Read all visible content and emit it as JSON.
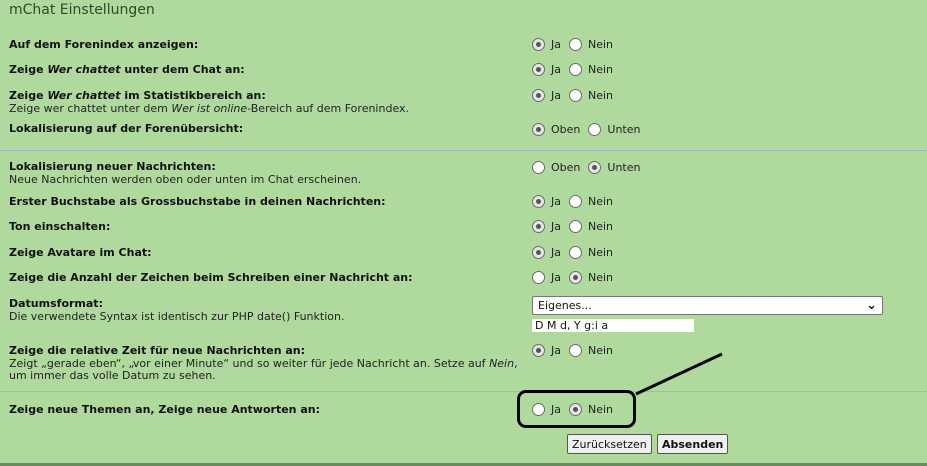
{
  "title": "mChat Einstellungen",
  "rows": [
    {
      "label": "Auf dem Forenindex anzeigen:",
      "opt1": "Ja",
      "opt2": "Nein",
      "selected": 1
    },
    {
      "label_parts": [
        "Zeige ",
        "Wer chattet",
        " unter dem Chat an:"
      ],
      "opt1": "Ja",
      "opt2": "Nein",
      "selected": 1
    },
    {
      "label_parts": [
        "Zeige ",
        "Wer chattet",
        " im Statistikbereich an:"
      ],
      "explain_parts": [
        "Zeige wer chattet unter dem ",
        "Wer ist online",
        "-Bereich auf dem Forenindex."
      ],
      "opt1": "Ja",
      "opt2": "Nein",
      "selected": 1
    },
    {
      "label": "Lokalisierung auf der Forenübersicht:",
      "opt1": "Oben",
      "opt2": "Unten",
      "selected": 1
    },
    {
      "label": "Lokalisierung neuer Nachrichten:",
      "explain": "Neue Nachrichten werden oben oder unten im Chat erscheinen.",
      "opt1": "Oben",
      "opt2": "Unten",
      "selected": 2
    },
    {
      "label": "Erster Buchstabe als Grossbuchstabe in deinen Nachrichten:",
      "opt1": "Ja",
      "opt2": "Nein",
      "selected": 1
    },
    {
      "label": "Ton einschalten:",
      "opt1": "Ja",
      "opt2": "Nein",
      "selected": 1
    },
    {
      "label": "Zeige Avatare im Chat:",
      "opt1": "Ja",
      "opt2": "Nein",
      "selected": 1
    },
    {
      "label": "Zeige die Anzahl der Zeichen beim Schreiben einer Nachricht an:",
      "opt1": "Ja",
      "opt2": "Nein",
      "selected": 2
    },
    {
      "label": "Datumsformat:",
      "explain": "Die verwendete Syntax ist identisch zur PHP date() Funktion."
    },
    {
      "label": "Zeige die relative Zeit für neue Nachrichten an:",
      "explain_parts": [
        "Zeigt „gerade eben“, „vor einer Minute“ und so weiter für jede Nachricht an. Setze auf ",
        "Nein",
        ", um immer das volle Datum zu sehen."
      ],
      "opt1": "Ja",
      "opt2": "Nein",
      "selected": 1
    },
    {
      "label": "Zeige neue Themen an, Zeige neue Antworten an:",
      "opt1": "Ja",
      "opt2": "Nein",
      "selected": 2
    }
  ],
  "date_select": {
    "value": "Eigenes..."
  },
  "date_input": {
    "value": "D M d, Y g:i a"
  },
  "buttons": {
    "reset": "Zurücksetzen",
    "submit": "Absenden"
  }
}
